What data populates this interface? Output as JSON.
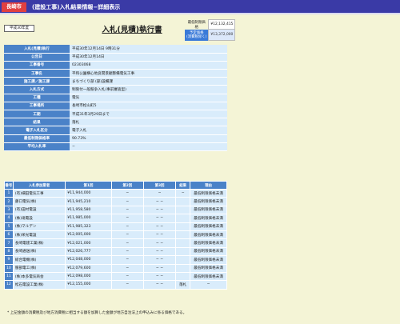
{
  "header": {
    "city": "長崎市",
    "title": "(建設工事)入札結果情報−詳細表示"
  },
  "era": "平成30年度",
  "main_title": "入札(見積)執行書",
  "prices": {
    "min_price_label": "最低制限価格",
    "min_price_value": "¥12,132,415",
    "estimate_label": "予定価格\n(消費税除く)",
    "estimate_value": "¥13,372,000"
  },
  "info": [
    {
      "label": "入札(見積)執行",
      "value": "平成30年12月14日 9時31分"
    },
    {
      "label": "公告日",
      "value": "平成30年12月14日"
    },
    {
      "label": "工事番号",
      "value": "02303068"
    },
    {
      "label": "工事名",
      "value": "平和公園横心地良間景観整備電気工事"
    },
    {
      "label": "施工課／施工課",
      "value": "まちづくり部 (部)設備課"
    },
    {
      "label": "入札方式",
      "value": "制限付一般競争入札(事前審査型)"
    },
    {
      "label": "工種",
      "value": "電気"
    },
    {
      "label": "工事場所",
      "value": "長崎市松山町5"
    },
    {
      "label": "工期",
      "value": "平成31年3月29日まで"
    },
    {
      "label": "結果",
      "value": "落札"
    },
    {
      "label": "電子入札区分",
      "value": "電子入札"
    },
    {
      "label": "最低制限価格率",
      "value": "90.73%"
    },
    {
      "label": "平均入札率",
      "value": "−"
    }
  ],
  "bid_headers": {
    "no": "番号",
    "name": "入札参加業者",
    "r1": "第1回",
    "r2": "第2回",
    "r3": "第3回",
    "result": "結果",
    "reason": "理由"
  },
  "bids": [
    {
      "no": "1",
      "name": "(有)細田電気工事",
      "r1": "¥11,944,000",
      "r2": "−",
      "r3": "−",
      "result": "−",
      "reason": "最低制限価格未満"
    },
    {
      "no": "2",
      "name": "藤口電気(株)",
      "r1": "¥11,945,210",
      "r2": "−",
      "r3": "− −",
      "result": "",
      "reason": "最低制限価格未満"
    },
    {
      "no": "3",
      "name": "(有)田村電設",
      "r1": "¥11,958,580",
      "r2": "−",
      "r3": "− −",
      "result": "",
      "reason": "最低制限価格未満"
    },
    {
      "no": "4",
      "name": "(株)滝電設",
      "r1": "¥11,985,000",
      "r2": "−",
      "r3": "− −",
      "result": "",
      "reason": "最低制限価格未満"
    },
    {
      "no": "5",
      "name": "(株)マルデン",
      "r1": "¥11,985,323",
      "r2": "−",
      "r3": "− −",
      "result": "",
      "reason": "最低制限価格未満"
    },
    {
      "no": "6",
      "name": "(株)栄光電設",
      "r1": "¥12,005,000",
      "r2": "−",
      "r3": "− −",
      "result": "",
      "reason": "最低制限価格未満"
    },
    {
      "no": "7",
      "name": "長崎電建工業(株)",
      "r1": "¥12,021,000",
      "r2": "−",
      "r3": "− −",
      "result": "",
      "reason": "最低制限価格未満"
    },
    {
      "no": "8",
      "name": "長崎通送(株)",
      "r1": "¥12,026,777",
      "r2": "−",
      "r3": "− −",
      "result": "",
      "reason": "最低制限価格未満"
    },
    {
      "no": "9",
      "name": "総合電機(株)",
      "r1": "¥12,048,000",
      "r2": "−",
      "r3": "− −",
      "result": "",
      "reason": "最低制限価格未満"
    },
    {
      "no": "10",
      "name": "服部電工(株)",
      "r1": "¥12,079,600",
      "r2": "−",
      "r3": "− −",
      "result": "",
      "reason": "最低制限価格未満"
    },
    {
      "no": "11",
      "name": "(株)本多電気商会",
      "r1": "¥12,098,000",
      "r2": "−",
      "r3": "− −",
      "result": "",
      "reason": "最低制限価格未満"
    },
    {
      "no": "12",
      "name": "松石電設工業(株)",
      "r1": "¥12,155,000",
      "r2": "−",
      "r3": "− −",
      "result": "落札",
      "reason": "−"
    }
  ],
  "footnote": "* 上記金額の消費税及び地方消費税に相当する額を加算した金額が地方自治法上の申込みに係る価格である。"
}
